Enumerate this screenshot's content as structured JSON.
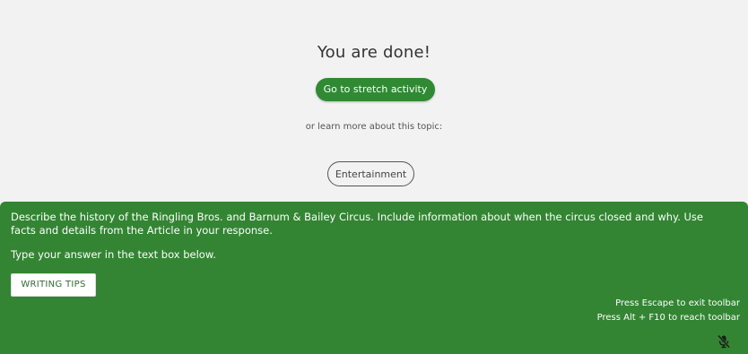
{
  "completion": {
    "title": "You are done!",
    "stretch_button_label": "Go to stretch activity",
    "learn_more_text": "or learn more about this topic:",
    "topic_label": "Entertainment"
  },
  "prompt": {
    "question": "Describe the history of the Ringling Bros. and Barnum & Bailey Circus. Include information about when the circus closed and why. Use facts and details from the Article in your response.",
    "instruction": "Type your answer in the text box below.",
    "writing_tips_label": "WRITING TIPS"
  },
  "toolbar": {
    "escape_hint": "Press Escape to exit toolbar",
    "alt_hint": "Press Alt + F10 to reach toolbar",
    "mic_icon": "microphone-off-icon"
  },
  "colors": {
    "page_background": "#f2f2f2",
    "accent_green": "#2f8a33",
    "panel_green": "#338533",
    "title_text": "#333333"
  }
}
